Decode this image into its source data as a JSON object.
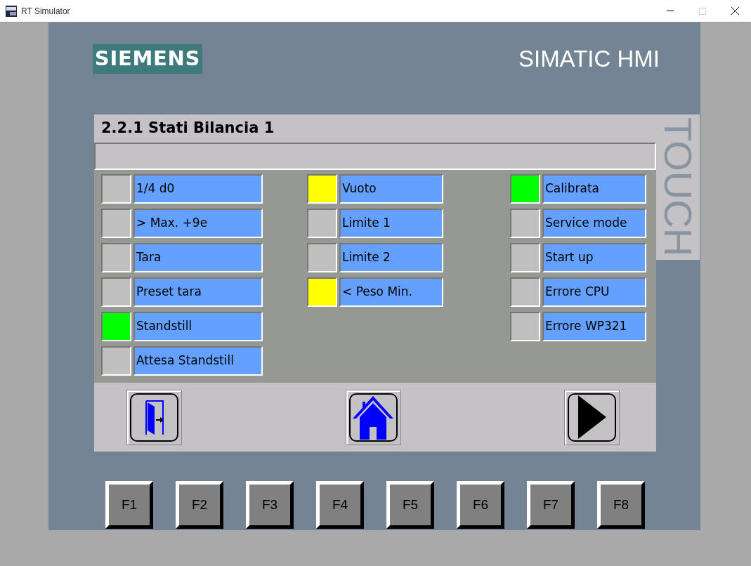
{
  "window": {
    "title": "RT Simulator"
  },
  "brand": {
    "logo": "SIEMENS",
    "product": "SIMATIC HMI",
    "side_label": "TOUCH"
  },
  "screen": {
    "title": "2.2.1 Stati Bilancia 1",
    "columns": [
      [
        {
          "label": "1/4 d0",
          "color": "#c0c0c0"
        },
        {
          "label": "> Max. +9e",
          "color": "#c0c0c0"
        },
        {
          "label": "Tara",
          "color": "#c0c0c0"
        },
        {
          "label": "Preset tara",
          "color": "#c0c0c0"
        },
        {
          "label": "Standstill",
          "color": "#00ff00"
        },
        {
          "label": "Attesa Standstill",
          "color": "#c0c0c0"
        }
      ],
      [
        {
          "label": "Vuoto",
          "color": "#ffff00"
        },
        {
          "label": "Limite 1",
          "color": "#c0c0c0"
        },
        {
          "label": "Limite 2",
          "color": "#c0c0c0"
        },
        {
          "label": "< Peso Min.",
          "color": "#ffff00"
        }
      ],
      [
        {
          "label": "Calibrata",
          "color": "#00ff00"
        },
        {
          "label": "Service mode",
          "color": "#c0c0c0"
        },
        {
          "label": "Start up",
          "color": "#c0c0c0"
        },
        {
          "label": "Errore CPU",
          "color": "#c0c0c0"
        },
        {
          "label": "Errore WP321",
          "color": "#c0c0c0"
        }
      ]
    ],
    "nav_buttons": [
      {
        "kind": "exit"
      },
      {
        "kind": "home"
      },
      {
        "kind": "next"
      }
    ]
  },
  "function_keys": [
    "F1",
    "F2",
    "F3",
    "F4",
    "F5",
    "F6",
    "F7",
    "F8"
  ]
}
